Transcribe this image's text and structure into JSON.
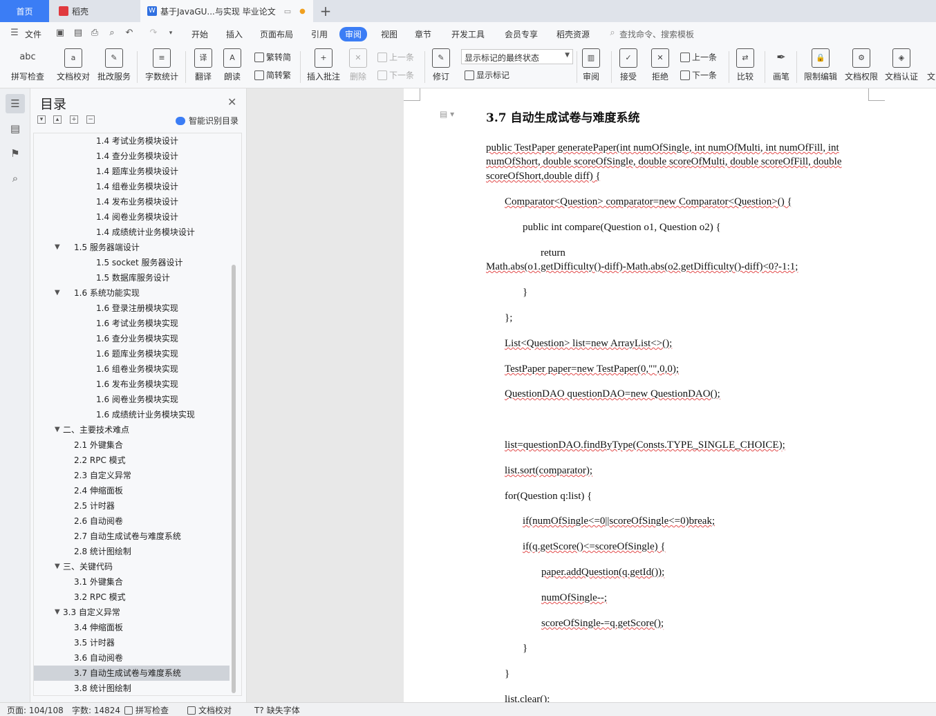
{
  "tabs": {
    "home": "首页",
    "daoke": "稻壳",
    "doc": "基于JavaGU...与实现 毕业论文",
    "plus": "+"
  },
  "menu": {
    "file": "文件",
    "items": [
      "开始",
      "插入",
      "页面布局",
      "引用",
      "审阅",
      "视图",
      "章节",
      "开发工具",
      "会员专享",
      "稻壳资源"
    ],
    "active": "审阅",
    "search_placeholder": "查找命令、搜索模板"
  },
  "ribbon": {
    "spell": "拼写检查",
    "proofread": "文档校对",
    "review_service": "批改服务",
    "wordcount": "字数统计",
    "translate": "翻译",
    "read_aloud": "朗读",
    "trad": "繁转简",
    "simp": "简转繁",
    "insert_comment": "插入批注",
    "delete": "删除",
    "prev_comment": "上一条",
    "next_comment": "下一条",
    "track": "修订",
    "markup_select": "显示标记的最终状态",
    "show_markup": "显示标记",
    "review": "审阅",
    "accept": "接受",
    "reject": "拒绝",
    "prev_change": "上一条",
    "next_change": "下一条",
    "compare": "比较",
    "pen": "画笔",
    "restrict": "限制编辑",
    "permission": "文档权限",
    "certify": "文档认证",
    "more": "文"
  },
  "toc": {
    "title": "目录",
    "smart": "智能识别目录",
    "items": [
      {
        "label": "1.4  考试业务模块设计",
        "level": 3
      },
      {
        "label": "1.4  查分业务模块设计",
        "level": 3
      },
      {
        "label": "1.4  题库业务模块设计",
        "level": 3
      },
      {
        "label": "1.4  组卷业务模块设计",
        "level": 3
      },
      {
        "label": "1.4  发布业务模块设计",
        "level": 3
      },
      {
        "label": "1.4  阅卷业务模块设计",
        "level": 3
      },
      {
        "label": "1.4  成绩统计业务模块设计",
        "level": 3
      },
      {
        "label": "1.5  服务器端设计",
        "level": 2
      },
      {
        "label": "1.5 socket  服务器设计",
        "level": 3
      },
      {
        "label": "1.5  数据库服务设计",
        "level": 3
      },
      {
        "label": "1.6  系统功能实现",
        "level": 2
      },
      {
        "label": "1.6  登录注册模块实现",
        "level": 3
      },
      {
        "label": "1.6  考试业务模块实现",
        "level": 3
      },
      {
        "label": "1.6  查分业务模块实现",
        "level": 3
      },
      {
        "label": "1.6  题库业务模块实现",
        "level": 3
      },
      {
        "label": "1.6  组卷业务模块实现",
        "level": 3
      },
      {
        "label": "1.6  发布业务模块实现",
        "level": 3
      },
      {
        "label": "1.6  阅卷业务模块实现",
        "level": 3
      },
      {
        "label": "1.6  成绩统计业务模块实现",
        "level": 3
      },
      {
        "label": "二、主要技术难点",
        "level": 1
      },
      {
        "label": "2.1  外键集合",
        "level": 2
      },
      {
        "label": "2.2 RPC  模式",
        "level": 2
      },
      {
        "label": "2.3  自定义异常",
        "level": 2
      },
      {
        "label": "2.4  伸缩面板",
        "level": 2
      },
      {
        "label": "2.5  计时器",
        "level": 2
      },
      {
        "label": "2.6  自动阅卷",
        "level": 2
      },
      {
        "label": "2.7  自动生成试卷与难度系统",
        "level": 2
      },
      {
        "label": "2.8  统计图绘制",
        "level": 2
      },
      {
        "label": "三、关键代码",
        "level": 1
      },
      {
        "label": "3.1  外键集合",
        "level": 2
      },
      {
        "label": "3.2 RPC  模式",
        "level": 2
      },
      {
        "label": "3.3  自定义异常",
        "level": 1
      },
      {
        "label": "3.4  伸缩面板",
        "level": 2
      },
      {
        "label": "3.5  计时器",
        "level": 2
      },
      {
        "label": "3.6  自动阅卷",
        "level": 2
      },
      {
        "label": "3.7  自动生成试卷与难度系统",
        "level": 2
      },
      {
        "label": "3.8  统计图绘制",
        "level": 2
      }
    ],
    "selected": "3.7  自动生成试卷与难度系统"
  },
  "doc": {
    "heading": "3.7  自动生成试卷与难度系统",
    "lines": [
      "public TestPaper generatePaper(int numOfSingle, int numOfMulti, int numOfFill, int",
      "numOfShort, double scoreOfSingle, double scoreOfMulti, double scoreOfFill, double",
      "scoreOfShort,double diff) {",
      "Comparator<Question> comparator=new Comparator<Question>() {",
      "public int compare(Question o1, Question o2) {",
      "return",
      "Math.abs(o1.getDifficulty()-diff)-Math.abs(o2.getDifficulty()-diff)<0?-1:1;",
      "}",
      "};",
      "List<Question> list=new ArrayList<>();",
      "TestPaper paper=new TestPaper(0,\"\",0,0);",
      "QuestionDAO questionDAO=new QuestionDAO();",
      "list=questionDAO.findByType(Consts.TYPE_SINGLE_CHOICE);",
      "list.sort(comparator);",
      "for(Question q:list) {",
      "if(numOfSingle<=0||scoreOfSingle<=0)break;",
      "if(q.getScore()<=scoreOfSingle) {",
      "paper.addQuestion(q.getId());",
      "numOfSingle--;",
      "scoreOfSingle-=q.getScore();",
      "}",
      "}",
      "list.clear();"
    ]
  },
  "status": {
    "page": "页面: 104/108",
    "words": "字数: 14824",
    "spell": "拼写检查",
    "proof": "文档校对",
    "missing_font": "缺失字体"
  }
}
